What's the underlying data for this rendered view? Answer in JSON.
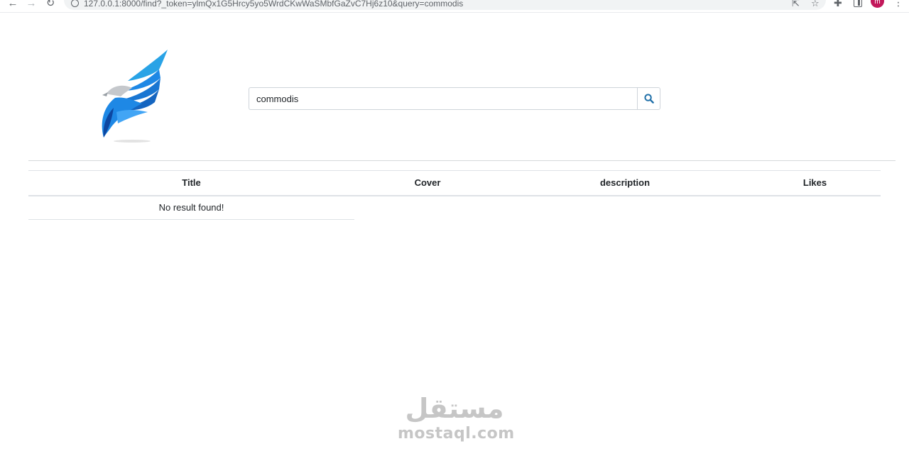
{
  "browser": {
    "url": "127.0.0.1:8000/find?_token=ylmQx1G5Hrcy5yo5WrdCKwWaSMbfGaZvC7Hj6z10&query=commodis",
    "avatar_initial": "m"
  },
  "search": {
    "value": "commodis"
  },
  "table": {
    "headers": [
      "Title",
      "Cover",
      "description",
      "Likes"
    ],
    "empty_message": "No result found!"
  },
  "watermark": {
    "arabic": "مستقل",
    "latin": "mostaql.com"
  },
  "colors": {
    "logo_blue": "#1e88e5",
    "logo_dark_blue": "#0d47a1",
    "search_icon": "#1f6fa8",
    "avatar": "#c2185b"
  }
}
